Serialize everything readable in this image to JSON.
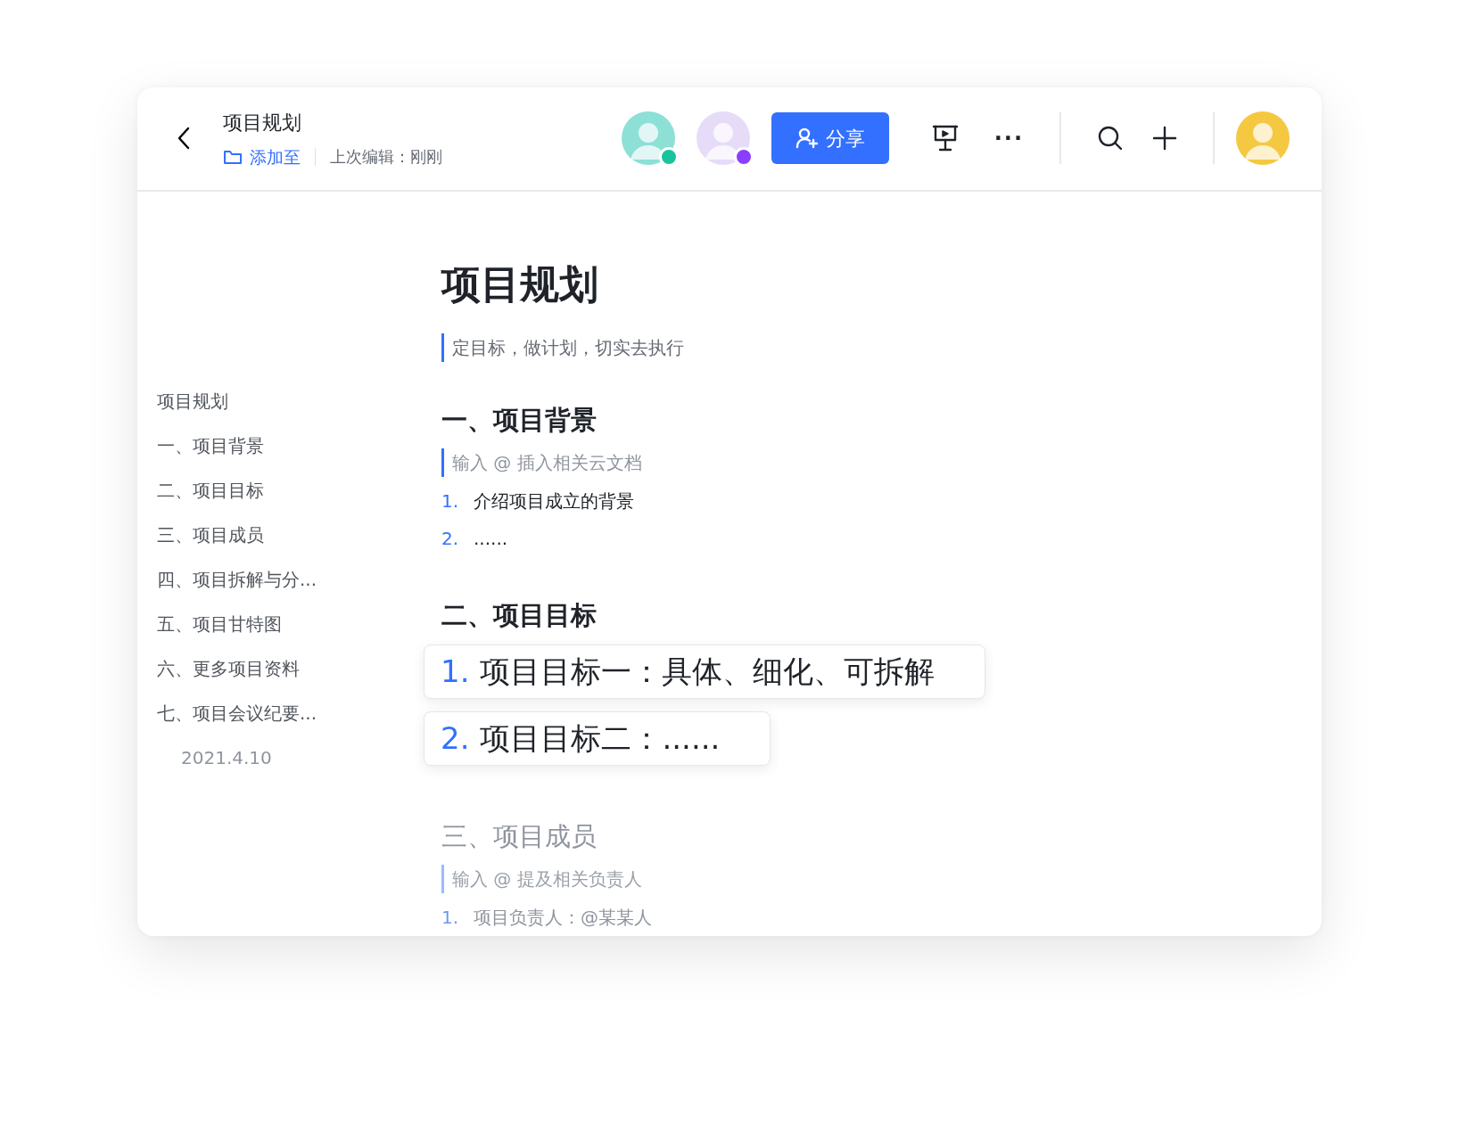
{
  "header": {
    "title": "项目规划",
    "folder_link": "添加至",
    "last_edit": "上次编辑：刚刚"
  },
  "collaborators": [
    {
      "color": "#19c39d"
    },
    {
      "color": "#8a3ffc"
    }
  ],
  "share_button": "分享",
  "more_glyph": "···",
  "outline": [
    {
      "label": "项目规划"
    },
    {
      "label": "一、项目背景"
    },
    {
      "label": "二、项目目标"
    },
    {
      "label": "三、项目成员"
    },
    {
      "label": "四、项目拆解与分..."
    },
    {
      "label": "五、项目甘特图"
    },
    {
      "label": "六、更多项目资料"
    },
    {
      "label": "七、项目会议纪要...",
      "children": [
        {
          "label": "2021.4.10"
        }
      ]
    }
  ],
  "document": {
    "title": "项目规划",
    "quote": "定目标，做计划，切实去执行",
    "sections": [
      {
        "heading": "一、项目背景",
        "faded": false,
        "hint": "输入 @ 插入相关云文档",
        "items": [
          {
            "kind": "plain",
            "number": "1.",
            "text": "介绍项目成立的背景"
          },
          {
            "kind": "plain",
            "number": "2.",
            "text": "......"
          }
        ]
      },
      {
        "heading": "二、项目目标",
        "faded": false,
        "items": [
          {
            "kind": "card",
            "number": "1.",
            "text": "项目目标一：具体、细化、可拆解"
          },
          {
            "kind": "card",
            "number": "2.",
            "text": "项目目标二：......"
          }
        ]
      },
      {
        "heading": "三、项目成员",
        "faded": true,
        "hint": "输入 @ 提及相关负责人",
        "items": [
          {
            "kind": "plain",
            "number": "1.",
            "text": "项目负责人：@某某人"
          }
        ]
      }
    ]
  }
}
